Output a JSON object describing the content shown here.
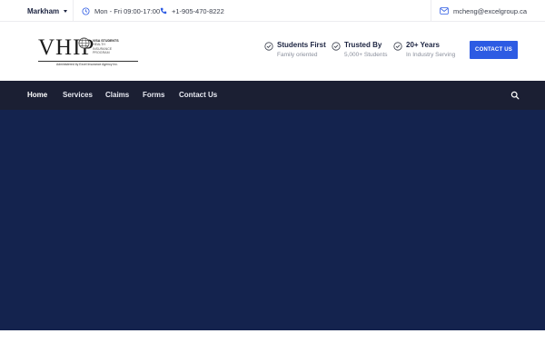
{
  "topbar": {
    "location": "Markham",
    "hours": "Mon - Fri 09:00-17:00",
    "phone": "+1-905-470-8222",
    "email": "mcheng@excelgroup.ca"
  },
  "logo": {
    "wordmark": "VHIP",
    "tagline_line1": "VISA STUDENTS",
    "tagline_line2": "HEALTH",
    "tagline_line3": "INSURANCE",
    "tagline_line4": "PROGRAM",
    "administered_by": "Administered by Excel Insurance Agency Inc."
  },
  "features": [
    {
      "title": "Students First",
      "subtitle": "Family oriented"
    },
    {
      "title": "Trusted By",
      "subtitle": "5,000+ Students"
    },
    {
      "title": "20+ Years",
      "subtitle": "In Industry Serving"
    }
  ],
  "cta": {
    "label": "CONTACT US"
  },
  "nav": {
    "items": [
      {
        "label": "Home"
      },
      {
        "label": "Services"
      },
      {
        "label": "Claims"
      },
      {
        "label": "Forms"
      },
      {
        "label": "Contact Us"
      }
    ],
    "active": "Home"
  },
  "icons": {
    "location_caret": "chevron-down-icon",
    "hours": "clock-icon",
    "phone": "phone-icon",
    "email": "mail-icon",
    "feature": "check-circle-icon",
    "search": "search-icon"
  },
  "colors": {
    "accent": "#2d5be3",
    "nav_bg": "#1b1f33",
    "hero_bg": "#14234e",
    "text_dark": "#1b2340",
    "text_muted": "#8a8f9c"
  }
}
